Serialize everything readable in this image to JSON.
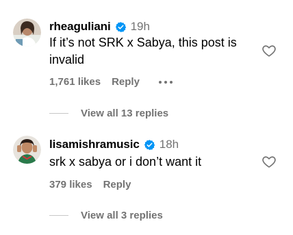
{
  "comments": [
    {
      "username": "rheaguliani",
      "verified": true,
      "time": "19h",
      "text_lines": [
        "If it’s not SRK x Sabya, this post is",
        "invalid"
      ],
      "likes": "1,761 likes",
      "reply_label": "Reply",
      "view_replies": "View all 13 replies",
      "avatar_icon": "avatar-photo",
      "like_icon": "heart-outline-icon"
    },
    {
      "username": "lisamishramusic",
      "verified": true,
      "time": "18h",
      "text_lines": [
        "srk x sabya or i don’t want it"
      ],
      "likes": "379 likes",
      "reply_label": "Reply",
      "view_replies": "View all 3 replies",
      "avatar_icon": "avatar-photo",
      "like_icon": "heart-outline-icon"
    }
  ],
  "colors": {
    "primary_text": "#000000",
    "secondary_text": "#737373",
    "verified_badge": "#0095f6",
    "divider": "#c7c7c7"
  }
}
